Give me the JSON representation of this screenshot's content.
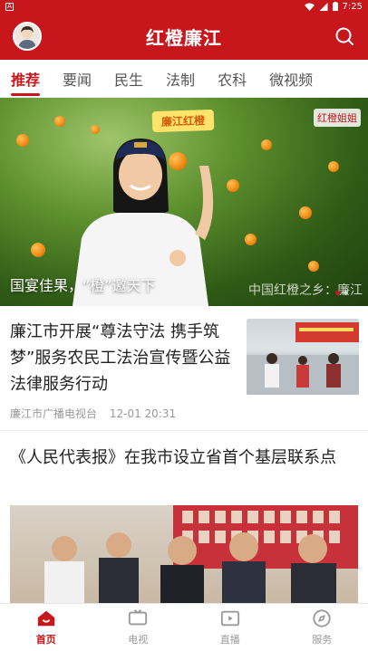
{
  "statusbar": {
    "time": "7:25",
    "app_badge": "A"
  },
  "header": {
    "title": "红橙廉江"
  },
  "tabs": [
    "推荐",
    "要闻",
    "民生",
    "法制",
    "农科",
    "微视频"
  ],
  "hero": {
    "caption": "国宴佳果，“橙”邀天下",
    "watermark": "中国红橙之乡：廉江",
    "badge": "红橙姐姐",
    "sign": "廉江红橙"
  },
  "news": [
    {
      "headline": "廉江市开展“尊法守法 携手筑梦”服务农民工法治宣传暨公益法律服务行动",
      "source": "廉江市广播电视台",
      "time": "12-01 20:31"
    },
    {
      "headline": "《人民代表报》在我市设立省首个基层联系点"
    }
  ],
  "bottom_nav": [
    {
      "label": "首页",
      "icon": "home-icon"
    },
    {
      "label": "电视",
      "icon": "tv-icon"
    },
    {
      "label": "直播",
      "icon": "live-icon"
    },
    {
      "label": "服务",
      "icon": "compass-icon"
    }
  ],
  "colors": {
    "brand": "#c8161d"
  }
}
